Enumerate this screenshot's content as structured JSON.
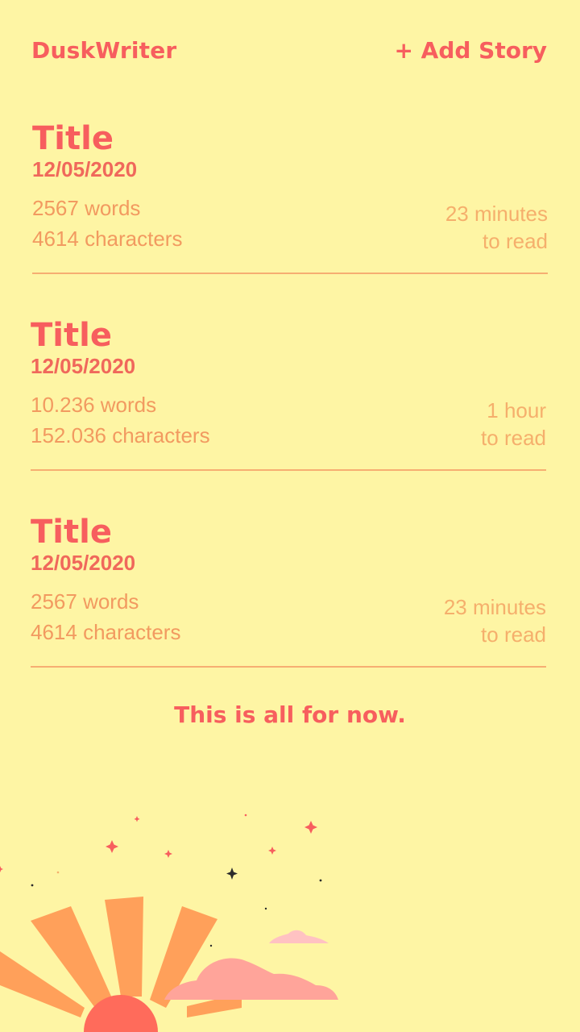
{
  "header": {
    "app_title": "DuskWriter",
    "add_story_label": "+ Add Story"
  },
  "stories": [
    {
      "title": "Title",
      "date": "12/05/2020",
      "words": "2567 words",
      "characters": "4614 characters",
      "read_time_line1": "23 minutes",
      "read_time_line2": "to read"
    },
    {
      "title": "Title",
      "date": "12/05/2020",
      "words": "10.236 words",
      "characters": "152.036 characters",
      "read_time_line1": "1 hour",
      "read_time_line2": "to read"
    },
    {
      "title": "Title",
      "date": "12/05/2020",
      "words": "2567 words",
      "characters": "4614 characters",
      "read_time_line1": "23 minutes",
      "read_time_line2": "to read"
    }
  ],
  "footer_note": "This is all for now.",
  "colors": {
    "background": "#FEF5A4",
    "accent": "#F75E5E",
    "muted": "#F29A60",
    "sun": "#FF6B5B",
    "rays": "#FFA05A",
    "cloud": "#FFA49A",
    "cloud_small": "#FFC2C2"
  },
  "illustration": {
    "icons": [
      "moon-icon",
      "sparkle-icon",
      "sun-icon",
      "cloud-icon"
    ]
  }
}
